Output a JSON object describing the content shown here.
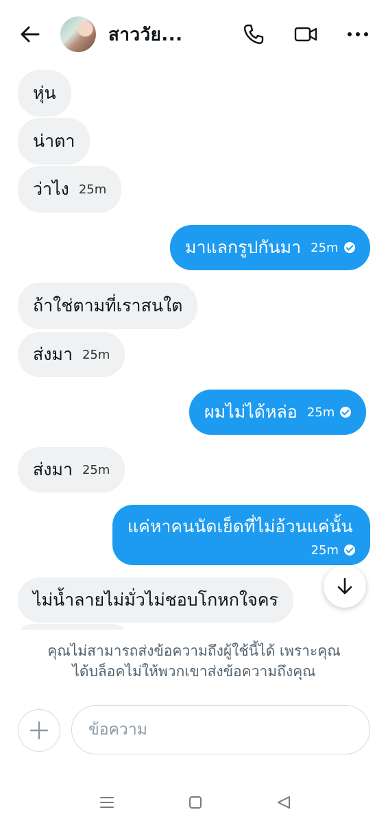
{
  "header": {
    "title": "สาววัย...",
    "icons": [
      "back-arrow-icon",
      "avatar",
      "phone-icon",
      "video-icon",
      "more-icon"
    ]
  },
  "messages": [
    {
      "dir": "in",
      "text": "หุ่น",
      "time": ""
    },
    {
      "dir": "in",
      "text": "น่าตา",
      "time": ""
    },
    {
      "dir": "in",
      "text": "ว่าไง",
      "time": "25m"
    },
    {
      "dir": "out",
      "text": "มาแลกรูปกันมา",
      "time": "25m"
    },
    {
      "dir": "in",
      "text": "ถ้าใช่ตามที่เราสนใต",
      "time": ""
    },
    {
      "dir": "in",
      "text": "ส่งมา",
      "time": "25m"
    },
    {
      "dir": "out",
      "text": "ผมไม่ได้หล่อ",
      "time": "25m"
    },
    {
      "dir": "in",
      "text": "ส่งมา",
      "time": "25m"
    },
    {
      "dir": "out",
      "text": "แค่หาคนนัดเย็ดที่ไม่อ้วนแค่นั้น",
      "time": "25m"
    },
    {
      "dir": "in",
      "text": "ไม่น้ำลายไม่มั่วไม่ชอบโกหกใจคร",
      "time": ""
    }
  ],
  "notice": {
    "line1": "คุณไม่สามารถส่งข้อความถึงผู้ใช้นี้ได้ เพราะคุณ",
    "line2": "ได้บล็อคไม่ให้พวกเขาส่งข้อความถึงคุณ"
  },
  "composer": {
    "placeholder": "ข้อความ"
  },
  "colors": {
    "outgoing_bubble": "#1d9bf0",
    "incoming_bubble": "#eff1f2",
    "notice_text": "#536471"
  }
}
